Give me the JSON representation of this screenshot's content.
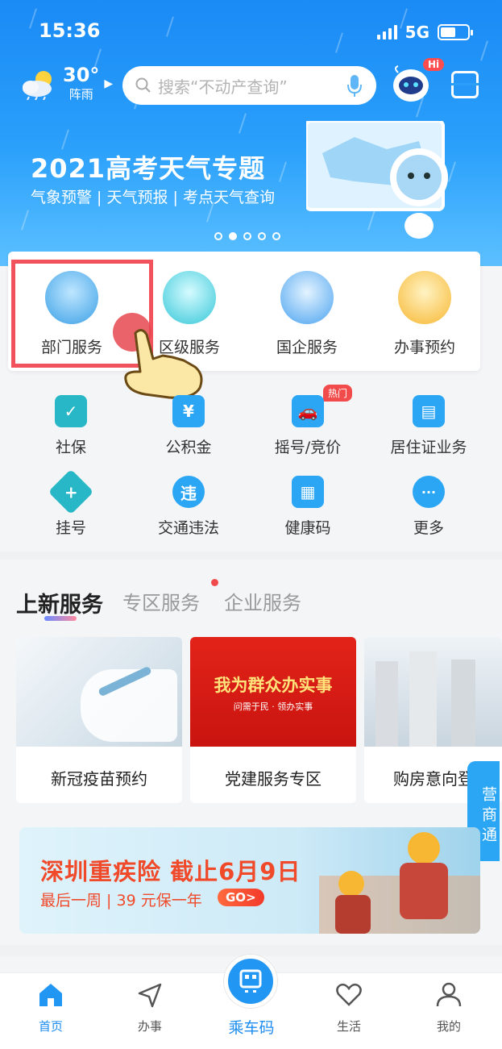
{
  "status_bar": {
    "time": "15:36",
    "network": "5G"
  },
  "weather": {
    "temp": "30°",
    "desc": "阵雨"
  },
  "search": {
    "placeholder": "搜索“不动产查询”"
  },
  "assistant": {
    "badge": "Hi"
  },
  "banner": {
    "title": "2021高考天气专题",
    "subtitle": "气象预警 | 天气预报 | 考点天气查询",
    "dots": 5,
    "active_dot": 1
  },
  "services": [
    {
      "label": "部门服务"
    },
    {
      "label": "区级服务"
    },
    {
      "label": "国企服务"
    },
    {
      "label": "办事预约"
    }
  ],
  "grid": [
    {
      "label": "社保",
      "icon": "shield-check-icon",
      "color": "#27b7c7"
    },
    {
      "label": "公积金",
      "icon": "house-yen-icon",
      "color": "#2aa6f5"
    },
    {
      "label": "摇号/竞价",
      "icon": "car-icon",
      "color": "#2aa6f5"
    },
    {
      "label": "居住证业务",
      "icon": "id-card-icon",
      "color": "#2aa6f5"
    },
    {
      "label": "挂号",
      "icon": "medical-plus-icon",
      "color": "#27b7c7"
    },
    {
      "label": "交通违法",
      "icon": "traffic-violation-icon",
      "color": "#2aa6f5"
    },
    {
      "label": "健康码",
      "icon": "health-code-icon",
      "color": "#2aa6f5"
    },
    {
      "label": "更多",
      "icon": "more-dots-icon",
      "color": "#2aa6f5"
    }
  ],
  "hot_badge": "热门",
  "tabs": [
    {
      "label": "上新服务",
      "active": true
    },
    {
      "label": "专区服务",
      "active": false
    },
    {
      "label": "企业服务",
      "active": false
    }
  ],
  "cards": [
    {
      "title": "新冠疫苗预约"
    },
    {
      "title": "党建服务专区",
      "image_text": "我为群众办实事",
      "image_sub": "问需于民 · 领办实事"
    },
    {
      "title": "购房意向登记"
    }
  ],
  "side_tab": "营商通",
  "ad": {
    "title": "深圳重疾险 截止6月9日",
    "subtitle": "最后一周 | 39 元保一年",
    "button": "GO>"
  },
  "tabbar": [
    {
      "label": "首页",
      "active": true
    },
    {
      "label": "办事",
      "active": false
    },
    {
      "label": "乘车码",
      "active": false
    },
    {
      "label": "生活",
      "active": false
    },
    {
      "label": "我的",
      "active": false
    }
  ]
}
